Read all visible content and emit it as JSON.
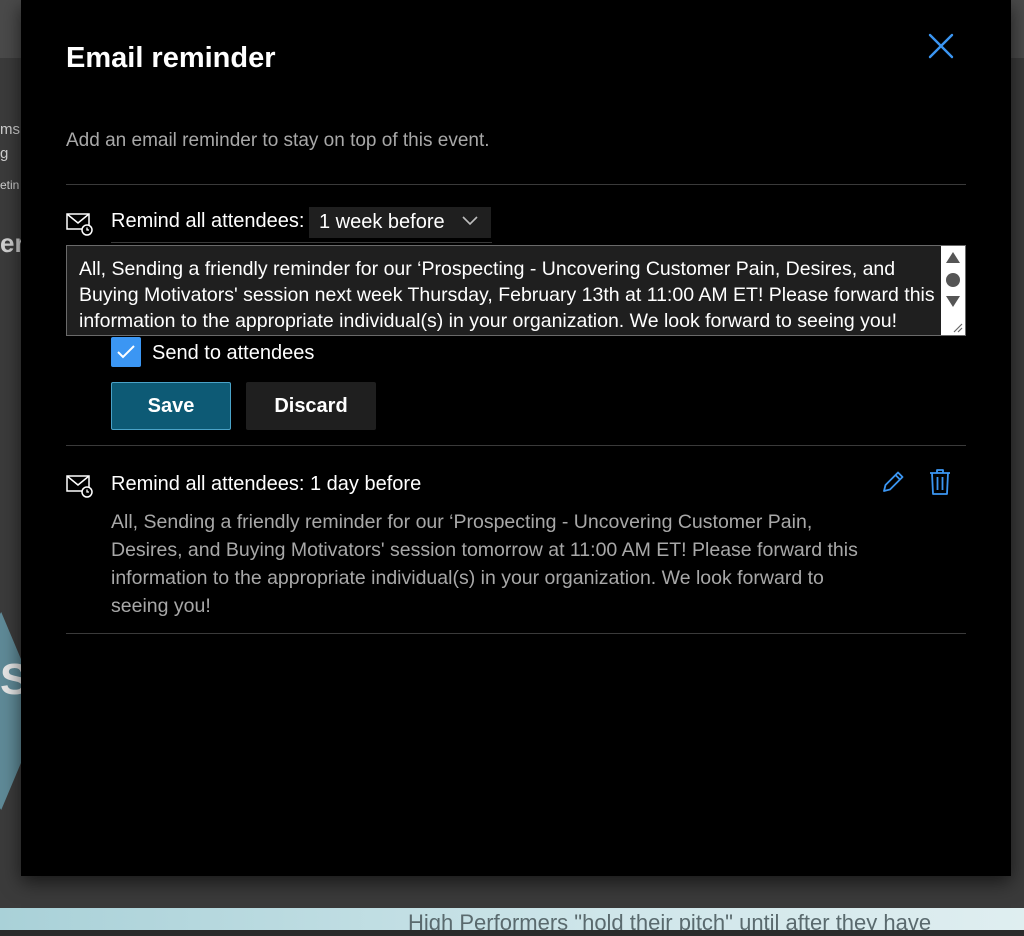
{
  "background": {
    "fragments": [
      "ms",
      "g",
      "etin",
      "eri"
    ],
    "hex_text": "Sl",
    "bottom_text": "High Performers \"hold their pitch\" until after they have"
  },
  "dialog": {
    "title": "Email reminder",
    "subtitle": "Add an email reminder to stay on top of this event.",
    "close_icon": "close-icon"
  },
  "edit_reminder": {
    "label": "Remind all attendees:",
    "timing": "1 week before",
    "message": "All, Sending a friendly reminder for our ‘Prospecting - Uncovering Customer Pain, Desires, and Buying Motivators' session next week Thursday, February 13th at 11:00 AM ET! Please forward this information to the appropriate individual(s) in your organization. We look forward to seeing you!",
    "send_to_attendees_label": "Send to attendees",
    "send_to_attendees_checked": true,
    "save_label": "Save",
    "discard_label": "Discard"
  },
  "existing_reminder": {
    "label": "Remind all attendees: 1 day before",
    "message": "All, Sending a friendly reminder for our ‘Prospecting - Uncovering Customer Pain, Desires, and Buying Motivators' session tomorrow at 11:00 AM ET! Please forward this information to the appropriate individual(s) in your organization. We look forward to seeing you!",
    "edit_icon": "pencil-icon",
    "delete_icon": "trash-icon"
  },
  "colors": {
    "accent": "#3b96f3",
    "primary_button": "#0d5a75",
    "muted_text": "#a8a8a8",
    "dialog_bg": "#000000"
  }
}
